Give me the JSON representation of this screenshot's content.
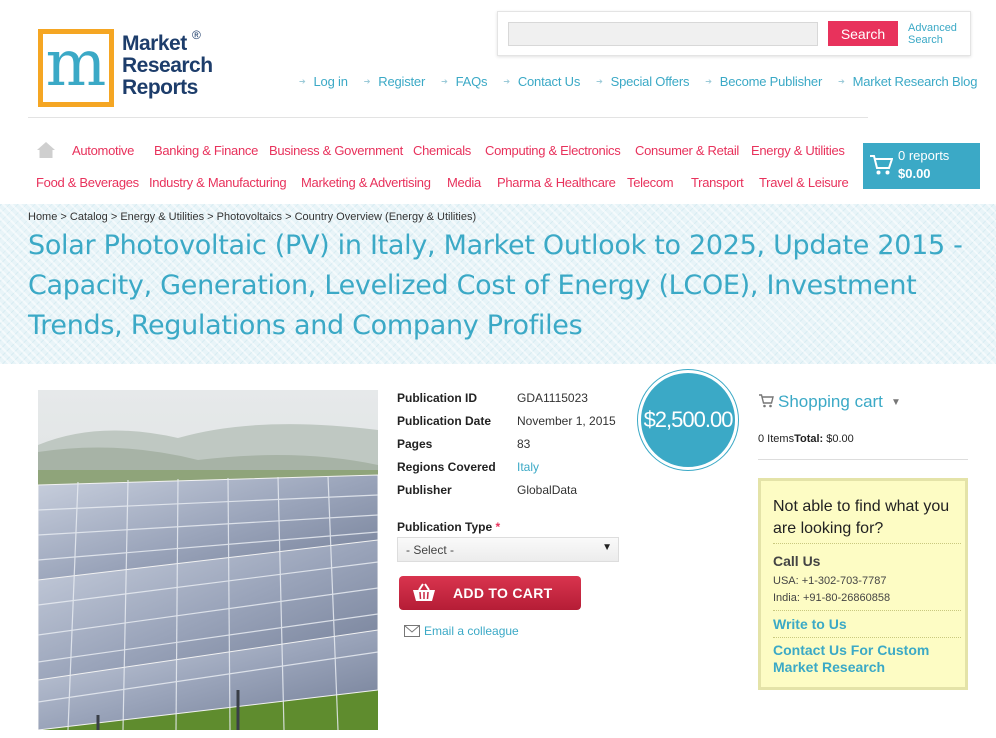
{
  "brand": {
    "logo_letter": "m",
    "logo_line1": "Market",
    "logo_line2": "Research",
    "logo_line3": "Reports",
    "registered": "®"
  },
  "search": {
    "placeholder": "",
    "button_label": "Search",
    "advanced_line1": "Advanced",
    "advanced_line2": "Search"
  },
  "top_links": [
    "Log in",
    "Register",
    "FAQs",
    "Contact Us",
    "Special Offers",
    "Become Publisher",
    "Market Research Blog"
  ],
  "categories_row1": [
    "Automotive",
    "Banking & Finance",
    "Business & Government",
    "Chemicals",
    "Computing & Electronics",
    "Consumer & Retail",
    "Energy & Utilities"
  ],
  "categories_row2": [
    "Food & Beverages",
    "Industry & Manufacturing",
    "Marketing & Advertising",
    "Media",
    "Pharma & Healthcare",
    "Telecom",
    "Transport",
    "Travel & Leisure"
  ],
  "header_cart": {
    "count_label": "0 reports",
    "total": "$0.00"
  },
  "breadcrumb": "Home > Catalog > Energy & Utilities > Photovoltaics > Country Overview (Energy & Utilities)",
  "title": "Solar Photovoltaic (PV) in Italy, Market Outlook to 2025, Update 2015 - Capacity, Generation, Levelized Cost of Energy (LCOE), Investment Trends, Regulations and Company Profiles",
  "details": [
    {
      "label": "Publication ID",
      "value": "GDA1115023"
    },
    {
      "label": "Publication Date",
      "value": "November 1, 2015"
    },
    {
      "label": "Pages",
      "value": "83"
    },
    {
      "label": "Regions Covered",
      "value": "Italy"
    },
    {
      "label": "Publisher",
      "value": "GlobalData"
    }
  ],
  "price": "$2,500.00",
  "publication_type": {
    "label": "Publication Type",
    "required_mark": "*",
    "selected": "- Select -"
  },
  "add_to_cart_label": "ADD TO CART",
  "email_colleague_label": "Email a colleague",
  "shopping_cart": {
    "title": "Shopping cart",
    "items_label": "0 Items",
    "total_label": "Total:",
    "total_value": "$0.00"
  },
  "help_box": {
    "question": "Not able to find what you are looking for?",
    "call_us": "Call Us",
    "phone_usa": "USA: +1-302-703-7787",
    "phone_india": "India: +91-80-26860858",
    "write_to_us": "Write to Us",
    "custom_research": "Contact Us For Custom Market Research"
  },
  "colors": {
    "accent_blue": "#3ba9c6",
    "accent_pink": "#e8325c",
    "logo_orange": "#f5a623",
    "logo_green": "#6bb43a"
  }
}
